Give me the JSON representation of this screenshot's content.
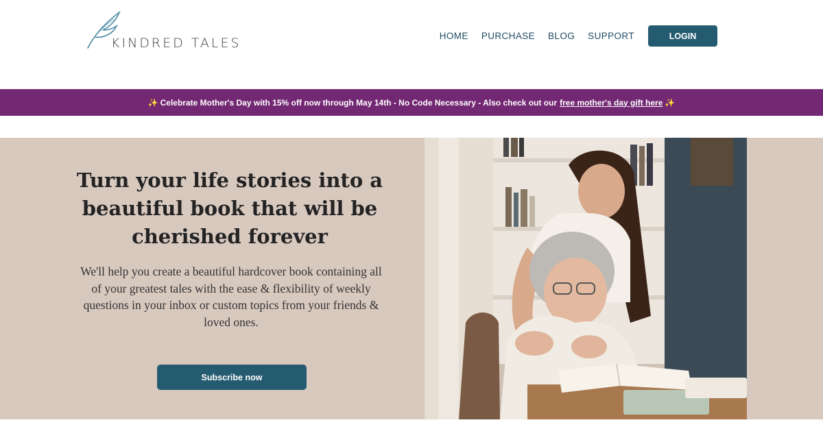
{
  "header": {
    "logo_text": "KINDRED  TALES",
    "logo_icon": "quill-feather-icon",
    "nav": [
      {
        "label": "HOME"
      },
      {
        "label": "PURCHASE"
      },
      {
        "label": "BLOG"
      },
      {
        "label": "SUPPORT"
      }
    ],
    "login_label": "LOGIN"
  },
  "promo": {
    "sparkle": "✨",
    "text": "Celebrate Mother's Day with 15% off now through May 14th - No Code Necessary - Also check out our",
    "link_text": "free mother's day gift here",
    "background": "#732873"
  },
  "hero": {
    "title": "Turn your life stories into a beautiful book that will be cherished forever",
    "description": "We'll help you create a beautiful hardcover book containing all of your greatest tales with the ease & flexibility of weekly questions in your inbox or custom topics from your friends & loved ones.",
    "cta_label": "Subscribe now",
    "background": "#d8c9bf",
    "button_color": "#255b70"
  }
}
